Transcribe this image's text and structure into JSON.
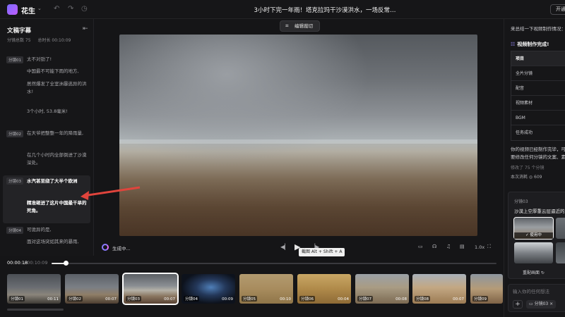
{
  "app": {
    "name": "花生",
    "caret": "⌄",
    "title": "3小时下完一年雨！塔克拉玛干沙漠洪水，一场反常…",
    "open_label": "开通"
  },
  "left_panel": {
    "title": "文稿字幕",
    "collapse_icon": "collapse-sidebar-icon",
    "segment_count": "分镜总数 75",
    "total_duration": "总时长 00:10:09",
    "segments": [
      {
        "tag": "分镜01",
        "lines": [
          "太不对劲了!",
          "中国最不可能下雨的地方,",
          "居然爆发了全室洲暴逃异的洪水!",
          "3个小时, 53.8毫米!"
        ]
      },
      {
        "tag": "分镜02",
        "lines": [
          "在天爷把整整一年的降雨量,",
          "在几个小时内全部倒进了沙漠深处。"
        ]
      },
      {
        "tag": "分镜03",
        "lines": [
          "水汽甚至绕了大半个欧洲",
          "精准砸进了这片中国最干旱的死角。"
        ]
      },
      {
        "tag": "分镜04",
        "lines": [
          "可诡异的是,",
          "面对这场突如其来的暴雨,"
        ]
      }
    ]
  },
  "toolbar": {
    "edit_crop_label": "编辑裁切"
  },
  "player": {
    "generating_label": "生成中...",
    "tooltip": "截图 Alt + Shift + A",
    "speed": "1.0x",
    "current_time": "00:00:18",
    "total_time": "/ 00:10:09",
    "progress": 0.03
  },
  "timeline": {
    "clips": [
      {
        "name": "分镜01",
        "dur": "00:11"
      },
      {
        "name": "分镜02",
        "dur": "00:07"
      },
      {
        "name": "分镜03",
        "dur": "00:07"
      },
      {
        "name": "分镜04",
        "dur": "00:09"
      },
      {
        "name": "分镜05",
        "dur": "00:10"
      },
      {
        "name": "分镜06",
        "dur": "00:04"
      },
      {
        "name": "分镜07",
        "dur": "00:08"
      },
      {
        "name": "分镜08",
        "dur": "00:07"
      },
      {
        "name": "分镜09",
        "dur": ""
      }
    ]
  },
  "right_panel": {
    "top_text": "来总结一下视频制作情况：",
    "done_title": "视频制作完成!",
    "table_rows": [
      "项目",
      "全片分镜",
      "配音",
      "视频素材",
      "BGM",
      "任务成功"
    ],
    "para_line1": "你的视频已经制作完毕，可",
    "para_line2": "要修改任何分镜的文案、素",
    "modified": "修改了 75 个分镜",
    "cost": "本次消耗 ◎ 609",
    "card_title": "分镜03",
    "card_desc": "沙漠上空厚重云层逼近的",
    "in_use": "✓ 使用中",
    "regen": "重配画面 ↻",
    "input_placeholder": "输入你的任何想法",
    "chip": "▭ 分镜03 ×"
  }
}
